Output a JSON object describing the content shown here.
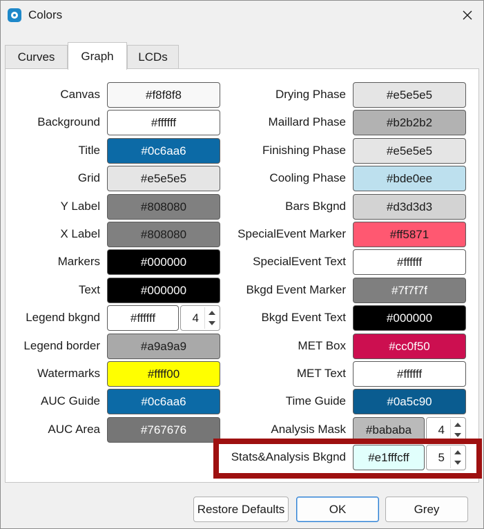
{
  "window": {
    "title": "Colors",
    "icon": "app-logo-icon",
    "close_icon": "close-icon"
  },
  "tabs": [
    {
      "label": "Curves",
      "active": false
    },
    {
      "label": "Graph",
      "active": true
    },
    {
      "label": "LCDs",
      "active": false
    }
  ],
  "left_column": [
    {
      "label": "Canvas",
      "value": "#f8f8f8",
      "color": "#f8f8f8",
      "text_color": "#1b1b1b"
    },
    {
      "label": "Background",
      "value": "#ffffff",
      "color": "#ffffff",
      "text_color": "#1b1b1b"
    },
    {
      "label": "Title",
      "value": "#0c6aa6",
      "color": "#0c6aa6",
      "text_color": "#ffffff"
    },
    {
      "label": "Grid",
      "value": "#e5e5e5",
      "color": "#e5e5e5",
      "text_color": "#1b1b1b"
    },
    {
      "label": "Y Label",
      "value": "#808080",
      "color": "#808080",
      "text_color": "#1b1b1b"
    },
    {
      "label": "X Label",
      "value": "#808080",
      "color": "#808080",
      "text_color": "#1b1b1b"
    },
    {
      "label": "Markers",
      "value": "#000000",
      "color": "#000000",
      "text_color": "#ffffff"
    },
    {
      "label": "Text",
      "value": "#000000",
      "color": "#000000",
      "text_color": "#ffffff"
    },
    {
      "label": "Legend bkgnd",
      "value": "#ffffff",
      "color": "#ffffff",
      "text_color": "#1b1b1b",
      "spin": "4"
    },
    {
      "label": "Legend border",
      "value": "#a9a9a9",
      "color": "#a9a9a9",
      "text_color": "#1b1b1b"
    },
    {
      "label": "Watermarks",
      "value": "#ffff00",
      "color": "#ffff00",
      "text_color": "#1b1b1b"
    },
    {
      "label": "AUC Guide",
      "value": "#0c6aa6",
      "color": "#0c6aa6",
      "text_color": "#ffffff"
    },
    {
      "label": "AUC Area",
      "value": "#767676",
      "color": "#767676",
      "text_color": "#ffffff"
    }
  ],
  "right_column": [
    {
      "label": "Drying Phase",
      "value": "#e5e5e5",
      "color": "#e5e5e5",
      "text_color": "#1b1b1b"
    },
    {
      "label": "Maillard Phase",
      "value": "#b2b2b2",
      "color": "#b2b2b2",
      "text_color": "#1b1b1b"
    },
    {
      "label": "Finishing Phase",
      "value": "#e5e5e5",
      "color": "#e5e5e5",
      "text_color": "#1b1b1b"
    },
    {
      "label": "Cooling Phase",
      "value": "#bde0ee",
      "color": "#bde0ee",
      "text_color": "#1b1b1b"
    },
    {
      "label": "Bars Bkgnd",
      "value": "#d3d3d3",
      "color": "#d3d3d3",
      "text_color": "#1b1b1b"
    },
    {
      "label": "SpecialEvent Marker",
      "value": "#ff5871",
      "color": "#ff5871",
      "text_color": "#1b1b1b"
    },
    {
      "label": "SpecialEvent Text",
      "value": "#ffffff",
      "color": "#ffffff",
      "text_color": "#1b1b1b"
    },
    {
      "label": "Bkgd Event Marker",
      "value": "#7f7f7f",
      "color": "#7f7f7f",
      "text_color": "#ffffff"
    },
    {
      "label": "Bkgd Event Text",
      "value": "#000000",
      "color": "#000000",
      "text_color": "#ffffff"
    },
    {
      "label": "MET Box",
      "value": "#cc0f50",
      "color": "#cc0f50",
      "text_color": "#ffffff"
    },
    {
      "label": "MET Text",
      "value": "#ffffff",
      "color": "#ffffff",
      "text_color": "#1b1b1b"
    },
    {
      "label": "Time Guide",
      "value": "#0a5c90",
      "color": "#0a5c90",
      "text_color": "#ffffff"
    },
    {
      "label": "Analysis Mask",
      "value": "#bababa",
      "color": "#bababa",
      "text_color": "#1b1b1b",
      "spin": "4"
    },
    {
      "label": "Stats&Analysis Bkgnd",
      "value": "#e1fffcff",
      "color": "#e1fffc",
      "text_color": "#1b1b1b",
      "spin": "5"
    }
  ],
  "buttons": {
    "restore": "Restore Defaults",
    "ok": "OK",
    "grey": "Grey"
  },
  "highlight_color": "#9e1010"
}
